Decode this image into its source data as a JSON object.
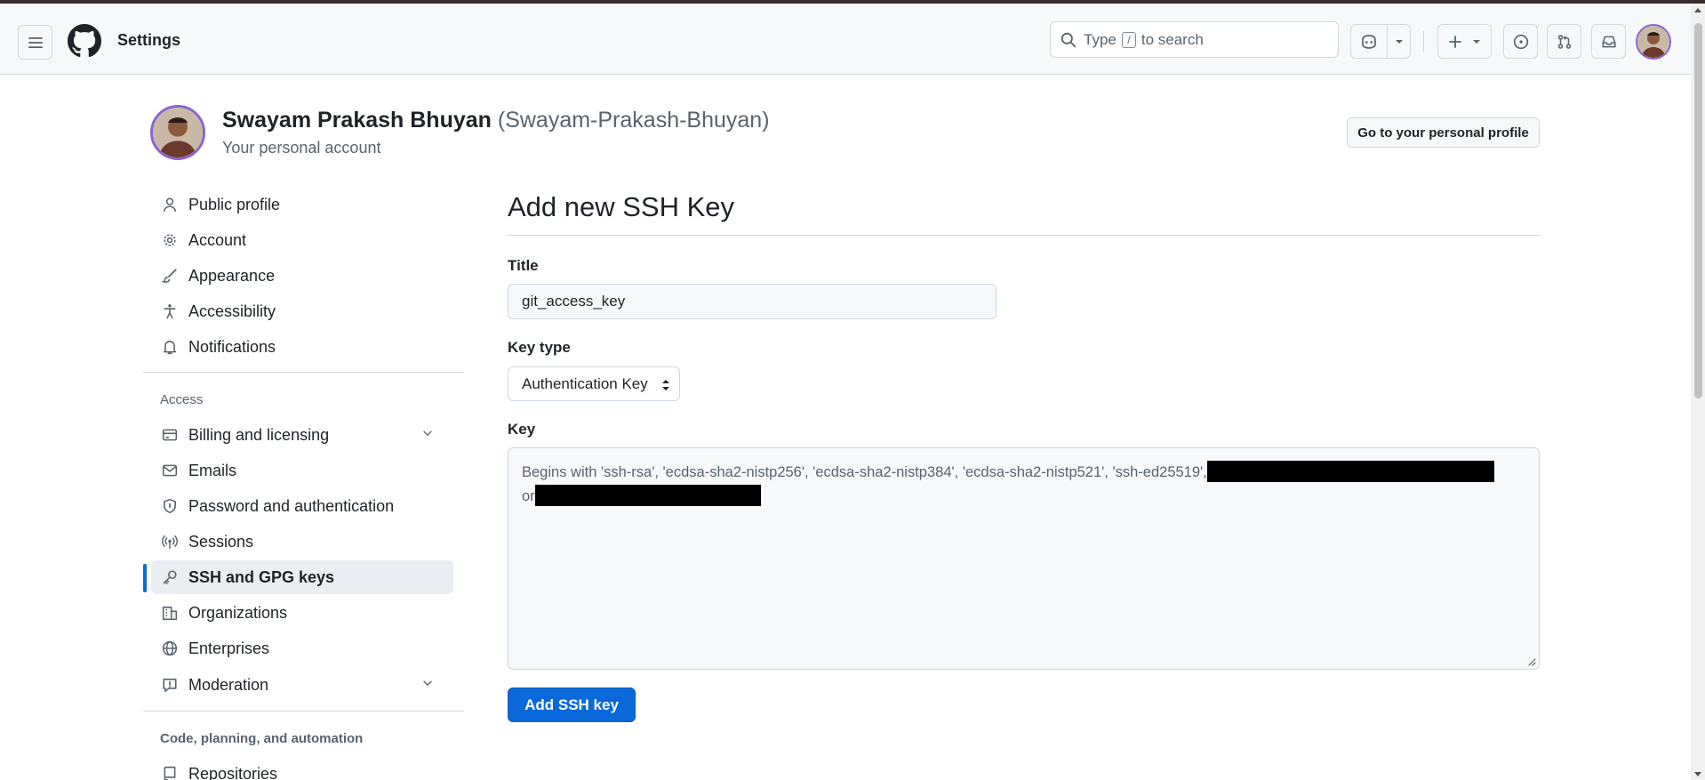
{
  "header": {
    "title": "Settings",
    "search_prefix": "Type",
    "search_key": "/",
    "search_suffix": "to search"
  },
  "account": {
    "name": "Swayam Prakash Bhuyan",
    "login": "(Swayam-Prakash-Bhuyan)",
    "subtitle": "Your personal account",
    "profile_button": "Go to your personal profile"
  },
  "sidebar": {
    "items": [
      {
        "label": "Public profile",
        "icon": "person-icon"
      },
      {
        "label": "Account",
        "icon": "gear-icon"
      },
      {
        "label": "Appearance",
        "icon": "paintbrush-icon"
      },
      {
        "label": "Accessibility",
        "icon": "accessibility-icon"
      },
      {
        "label": "Notifications",
        "icon": "bell-icon"
      }
    ],
    "access_heading": "Access",
    "access_items": [
      {
        "label": "Billing and licensing",
        "icon": "credit-card-icon"
      },
      {
        "label": "Emails",
        "icon": "mail-icon"
      },
      {
        "label": "Password and authentication",
        "icon": "shield-icon"
      },
      {
        "label": "Sessions",
        "icon": "broadcast-icon"
      },
      {
        "label": "SSH and GPG keys",
        "icon": "key-icon",
        "active": true
      },
      {
        "label": "Organizations",
        "icon": "organization-icon"
      },
      {
        "label": "Enterprises",
        "icon": "globe-icon"
      },
      {
        "label": "Moderation",
        "icon": "report-icon"
      }
    ],
    "code_heading": "Code, planning, and automation",
    "code_items": [
      {
        "label": "Repositories",
        "icon": "repo-icon"
      }
    ]
  },
  "form": {
    "heading": "Add new SSH Key",
    "title_label": "Title",
    "title_value": "git_access_key",
    "key_type_label": "Key type",
    "key_type_value": "Authentication Key",
    "key_label": "Key",
    "key_placeholder_start": "Begins with 'ssh-rsa', 'ecdsa-sha2-nistp256', 'ecdsa-sha2-nistp384', 'ecdsa-sha2-nistp521', 'ssh-ed25519',",
    "key_placeholder_or": "or",
    "submit_label": "Add SSH key"
  },
  "colors": {
    "accent": "#0969da",
    "avatar_ring": "#8a63d2"
  }
}
